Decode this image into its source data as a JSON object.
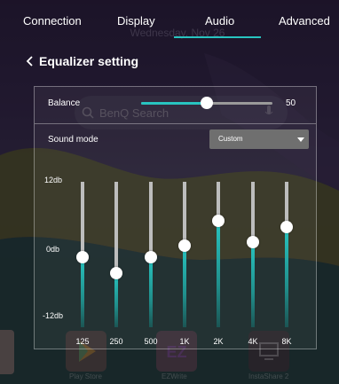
{
  "tabs": [
    {
      "label": "Connection",
      "active": false
    },
    {
      "label": "Display",
      "active": false
    },
    {
      "label": "Audio",
      "active": true
    },
    {
      "label": "Advanced",
      "active": false
    }
  ],
  "background": {
    "clock_text": "Wednesday, Nov 26",
    "search_placeholder": "BenQ Search",
    "dock": [
      {
        "label": "Play Store",
        "icon": "play-store-icon"
      },
      {
        "label": "EZWrite",
        "icon": "ezwrite-icon"
      },
      {
        "label": "InstaShare 2",
        "icon": "instashare-icon"
      }
    ]
  },
  "header": {
    "back_icon": "chevron-left-icon",
    "title": "Equalizer setting"
  },
  "balance": {
    "label": "Balance",
    "value": "50",
    "min": 0,
    "max": 100
  },
  "sound_mode": {
    "label": "Sound mode",
    "selected": "Custom"
  },
  "equalizer": {
    "scale_labels": {
      "top": "12db",
      "middle": "0db",
      "bottom": "-12db"
    },
    "range": [
      -12,
      12
    ],
    "bands": [
      {
        "freq": "125",
        "gain": -0.5
      },
      {
        "freq": "250",
        "gain": -3.0
      },
      {
        "freq": "500",
        "gain": -0.5
      },
      {
        "freq": "1K",
        "gain": 1.5
      },
      {
        "freq": "2K",
        "gain": 5.5
      },
      {
        "freq": "4K",
        "gain": 2.0
      },
      {
        "freq": "8K",
        "gain": 4.5
      }
    ]
  },
  "colors": {
    "accent": "#28c4c0",
    "track": "#bdbdbd",
    "select_bg": "#6f6f6f"
  }
}
